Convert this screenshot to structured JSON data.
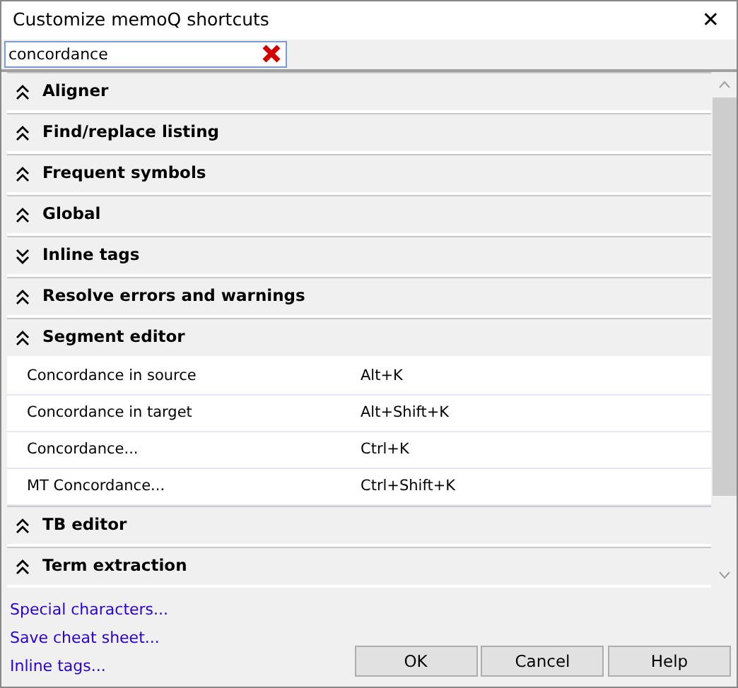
{
  "window": {
    "title": "Customize memoQ shortcuts",
    "close": "✕"
  },
  "search": {
    "value": "concordance"
  },
  "groups": [
    {
      "name": "Aligner",
      "expanded": true
    },
    {
      "name": "Find/replace listing",
      "expanded": true
    },
    {
      "name": "Frequent symbols",
      "expanded": true
    },
    {
      "name": "Global",
      "expanded": true
    },
    {
      "name": "Inline tags",
      "expanded": false
    },
    {
      "name": "Resolve errors and warnings",
      "expanded": true
    },
    {
      "name": "Segment editor",
      "expanded": true,
      "shortcuts": [
        {
          "command": "Concordance in source",
          "keys": "Alt+K"
        },
        {
          "command": "Concordance in target",
          "keys": "Alt+Shift+K"
        },
        {
          "command": "Concordance...",
          "keys": "Ctrl+K"
        },
        {
          "command": "MT Concordance...",
          "keys": "Ctrl+Shift+K"
        }
      ]
    },
    {
      "name": "TB editor",
      "expanded": true
    },
    {
      "name": "Term extraction",
      "expanded": true
    }
  ],
  "links": [
    "Special characters...",
    "Save cheat sheet...",
    "Inline tags..."
  ],
  "buttons": [
    "OK",
    "Cancel",
    "Help"
  ]
}
